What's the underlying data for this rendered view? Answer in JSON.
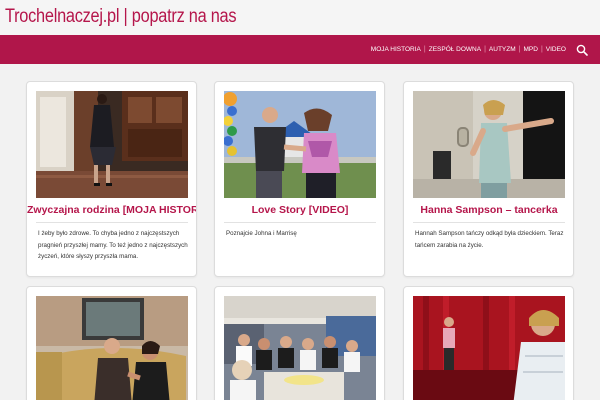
{
  "site": {
    "title": "Trochelnaczej.pl | popatrz na nas"
  },
  "nav": {
    "items": [
      "MOJA HISTORIA",
      "ZESPÓŁ DOWNA",
      "AUTYZM",
      "MPD",
      "VIDEO"
    ],
    "search_icon": "search-icon"
  },
  "colors": {
    "accent": "#b0164a",
    "title": "#b5164b",
    "background": "#f2f2f2"
  },
  "posts": [
    {
      "title": "Zwyczajna rodzina [MOJA HISTORIA]",
      "excerpt": "I żeby było zdrowe. To chyba jedno z najczęstszych pragnień przyszłej mamy. To też jedno z najczęstszych życzeń, które słyszy przyszła mama."
    },
    {
      "title": "Love Story [VIDEO]",
      "excerpt": "Poznajcie Johna i Marrisę"
    },
    {
      "title": "Hanna Sampson – tancerka",
      "excerpt": "Hannah Sampson tańczy odkąd była dzieckiem. Teraz tańcem zarabia na życie."
    },
    {
      "title": "",
      "excerpt": ""
    },
    {
      "title": "",
      "excerpt": ""
    },
    {
      "title": "",
      "excerpt": ""
    }
  ]
}
